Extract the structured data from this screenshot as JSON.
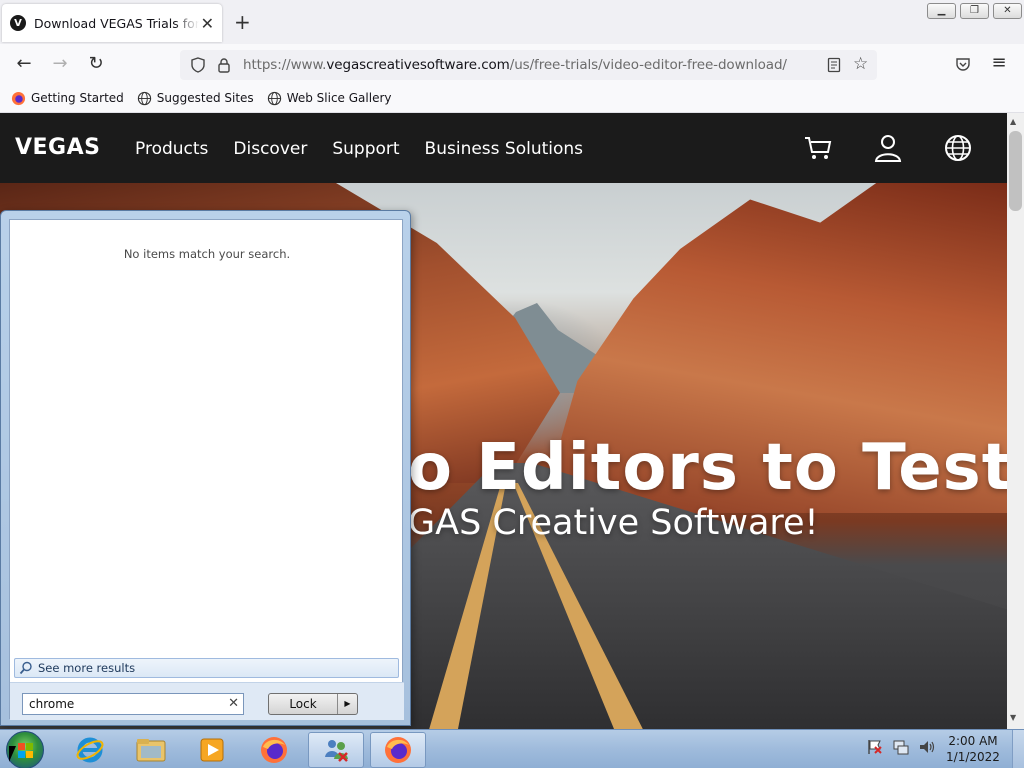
{
  "browser": {
    "tab_title": "Download VEGAS Trials for Free",
    "tab_favicon_letter": "V",
    "url_prefix": "https://www.",
    "url_domain": "vegascreativesoftware.com",
    "url_path": "/us/free-trials/video-editor-free-download/",
    "bookmarks": [
      {
        "label": "Getting Started",
        "icon": "firefox-icon"
      },
      {
        "label": "Suggested Sites",
        "icon": "globe-icon"
      },
      {
        "label": "Web Slice Gallery",
        "icon": "globe-icon"
      }
    ]
  },
  "site": {
    "logo": "VEGAS",
    "nav": [
      "Products",
      "Discover",
      "Support",
      "Business Solutions"
    ],
    "hero_title": "o Editors to Test:",
    "hero_subtitle": "GAS Creative Software!"
  },
  "start_menu": {
    "no_items": "No items match your search.",
    "see_more": "See more results",
    "search_value": "chrome",
    "lock_label": "Lock"
  },
  "taskbar": {
    "clock_time": "2:00 AM",
    "clock_date": "1/1/2022",
    "items": [
      "internet-explorer-icon",
      "file-explorer-icon",
      "media-player-icon",
      "firefox-icon",
      "network-users-icon",
      "firefox-icon"
    ]
  },
  "colors": {
    "site_header": "#1b1b1b",
    "taskbar": "#9fbbdc"
  }
}
